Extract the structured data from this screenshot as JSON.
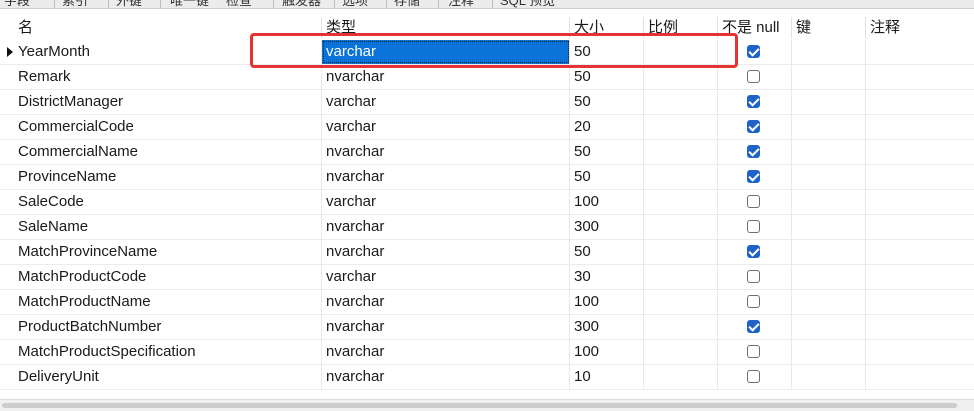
{
  "tabs": [
    "字段",
    "索引",
    "外键",
    "唯一键",
    "检查",
    "触发器",
    "选项",
    "存储",
    "注释",
    "SQL 预览"
  ],
  "headers": {
    "name": "名",
    "type": "类型",
    "size": "大小",
    "scale": "比例",
    "not_null": "不是 null",
    "key": "键",
    "comment": "注释"
  },
  "rows": [
    {
      "name": "YearMonth",
      "type": "varchar",
      "size": "50",
      "not_null": true
    },
    {
      "name": "Remark",
      "type": "nvarchar",
      "size": "50",
      "not_null": false
    },
    {
      "name": "DistrictManager",
      "type": "varchar",
      "size": "50",
      "not_null": true
    },
    {
      "name": "CommercialCode",
      "type": "varchar",
      "size": "20",
      "not_null": true
    },
    {
      "name": "CommercialName",
      "type": "nvarchar",
      "size": "50",
      "not_null": true
    },
    {
      "name": "ProvinceName",
      "type": "nvarchar",
      "size": "50",
      "not_null": true
    },
    {
      "name": "SaleCode",
      "type": "varchar",
      "size": "100",
      "not_null": false
    },
    {
      "name": "SaleName",
      "type": "nvarchar",
      "size": "300",
      "not_null": false
    },
    {
      "name": "MatchProvinceName",
      "type": "nvarchar",
      "size": "50",
      "not_null": true
    },
    {
      "name": "MatchProductCode",
      "type": "varchar",
      "size": "30",
      "not_null": false
    },
    {
      "name": "MatchProductName",
      "type": "nvarchar",
      "size": "100",
      "not_null": false
    },
    {
      "name": "ProductBatchNumber",
      "type": "nvarchar",
      "size": "300",
      "not_null": true
    },
    {
      "name": "MatchProductSpecification",
      "type": "nvarchar",
      "size": "100",
      "not_null": false
    },
    {
      "name": "DeliveryUnit",
      "type": "nvarchar",
      "size": "10",
      "not_null": false
    }
  ],
  "selected_row": 0,
  "colors": {
    "selection": "#0a73d9",
    "highlight_box": "#e53333",
    "checkbox_on": "#1f63c9"
  }
}
